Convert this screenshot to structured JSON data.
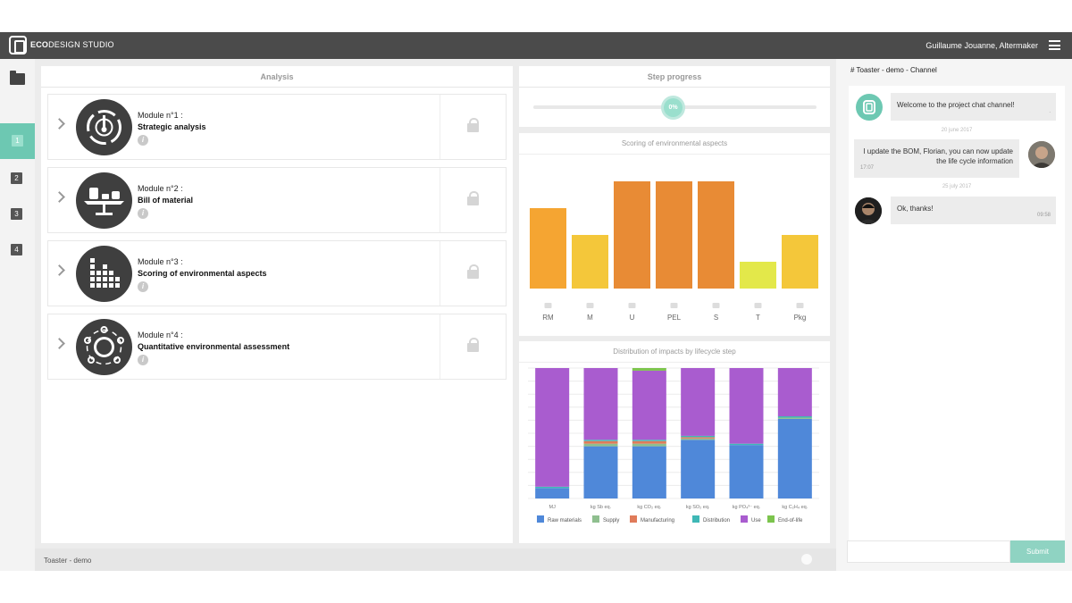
{
  "app": {
    "brand_bold": "ECO",
    "brand_rest": "DESIGN STUDIO",
    "user": "Guillaume Jouanne, Altermaker"
  },
  "rail": {
    "steps": [
      "1",
      "2",
      "3",
      "4"
    ]
  },
  "analysis": {
    "title": "Analysis",
    "modules": [
      {
        "number": "Module n°1 :",
        "title": "Strategic analysis",
        "icon": "compass-icon"
      },
      {
        "number": "Module n°2 :",
        "title": "Bill of material",
        "icon": "balance-scale-icon"
      },
      {
        "number": "Module n°3 :",
        "title": "Scoring of environmental aspects",
        "icon": "grid-chart-icon"
      },
      {
        "number": "Module n°4 :",
        "title": "Quantitative environmental assessment",
        "icon": "lifecycle-icon"
      }
    ],
    "info_glyph": "i"
  },
  "progress": {
    "title": "Step progress",
    "value": "0%"
  },
  "chart_data": [
    {
      "type": "bar",
      "title": "Scoring of environmental aspects",
      "categories": [
        "RM",
        "M",
        "U",
        "PEL",
        "S",
        "T",
        "Pkg"
      ],
      "values": [
        3,
        2,
        4,
        4,
        4,
        1,
        2
      ],
      "ylim": [
        0,
        4
      ],
      "colors": [
        "#f5a532",
        "#f4c73a",
        "#e88b35",
        "#e88b35",
        "#e88b35",
        "#e3e84a",
        "#f4c73a"
      ],
      "grid": false
    },
    {
      "type": "bar",
      "stacked": true,
      "title": "Distribution of impacts by lifecycle step",
      "categories": [
        "MJ",
        "kg Sb eq.",
        "kg CO₂ eq.",
        "kg SO₂ eq.",
        "kg PO₄³⁻ eq.",
        "kg C₂H₄ eq."
      ],
      "ylim": [
        0,
        100
      ],
      "series": [
        {
          "name": "Raw materials",
          "color": "#4f88d9",
          "values": [
            8,
            40,
            40,
            45,
            41,
            61
          ]
        },
        {
          "name": "Supply",
          "color": "#8fbf8f",
          "values": [
            0,
            2,
            2,
            1,
            0,
            1
          ]
        },
        {
          "name": "Manufacturing",
          "color": "#e07b5a",
          "values": [
            0,
            2,
            2,
            1,
            0,
            0
          ]
        },
        {
          "name": "Distribution",
          "color": "#3fb8b6",
          "values": [
            1,
            1,
            1,
            1,
            1,
            1
          ]
        },
        {
          "name": "Use",
          "color": "#a95ccf",
          "values": [
            91,
            55,
            53,
            52,
            58,
            37
          ]
        },
        {
          "name": "End-of-life",
          "color": "#7cc44d",
          "values": [
            0,
            0,
            2,
            0,
            0,
            0
          ]
        }
      ],
      "legend": "bottom",
      "grid": true
    }
  ],
  "chat": {
    "channel": "# Toaster - demo - Channel",
    "messages": [
      {
        "text": "Welcome to the project chat channel!",
        "time": "."
      },
      {
        "text_line1": "I update the BOM, Florian, you can now update",
        "text_line2": "the life cycle information",
        "time": "17:07",
        "date_before": "20 june 2017"
      },
      {
        "text": "Ok, thanks!",
        "time": "09:58",
        "date_before": "25 july 2017"
      }
    ],
    "submit_label": "Submit"
  },
  "footer": {
    "project": "Toaster - demo"
  }
}
